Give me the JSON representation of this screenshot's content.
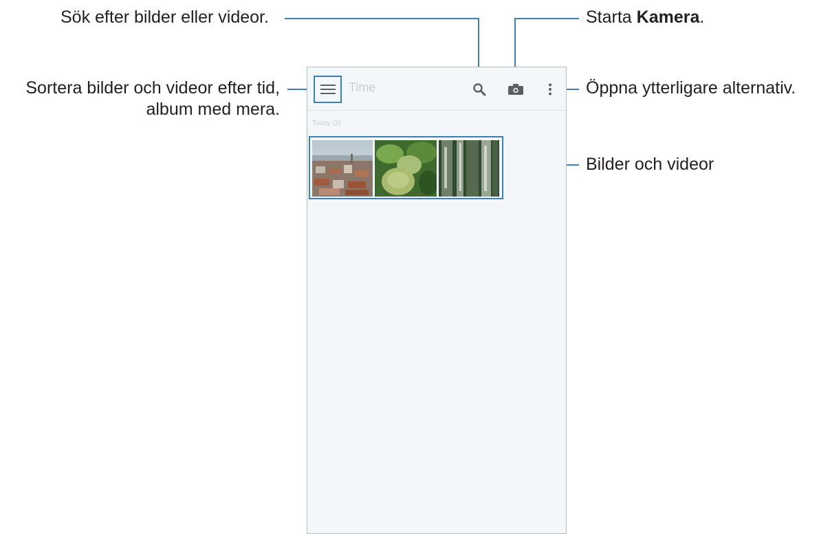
{
  "callouts": {
    "search": "Sök efter bilder eller videor.",
    "camera_prefix": "Starta ",
    "camera_bold": "Kamera",
    "camera_suffix": ".",
    "menu_line1": "Sortera bilder och videor efter tid,",
    "menu_line2": "album med mera.",
    "more": "Öppna ytterligare alternativ.",
    "media": "Bilder och videor"
  },
  "app": {
    "title": "Time",
    "section_label": "Today (3)"
  },
  "icons": {
    "menu": "hamburger-menu-icon",
    "search": "search-icon",
    "camera": "camera-icon",
    "more": "more-options-icon"
  },
  "thumbnails": [
    {
      "name": "city-photo"
    },
    {
      "name": "plant-buds-photo"
    },
    {
      "name": "tree-bark-photo"
    }
  ],
  "colors": {
    "accent": "#3d7fb3",
    "text": "#231f20",
    "screen_bg": "#f4f7f9",
    "icon": "#5a5f63"
  }
}
